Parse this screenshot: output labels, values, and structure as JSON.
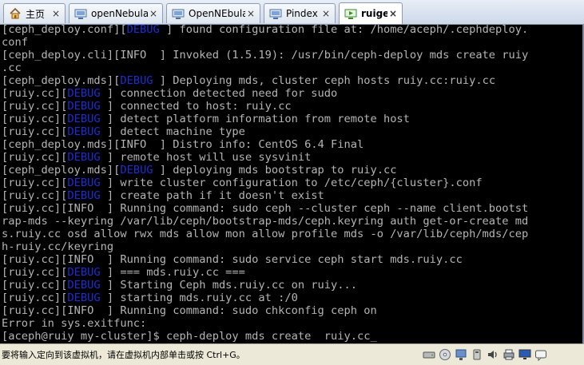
{
  "tabs": [
    {
      "label": "主页",
      "icon": "home-icon",
      "active": false
    },
    {
      "label": "openNebula",
      "icon": "vm-icon",
      "active": false
    },
    {
      "label": "OpenNEbula",
      "icon": "vm-icon",
      "active": false
    },
    {
      "label": "Pindex",
      "icon": "vm-icon",
      "active": false
    },
    {
      "label": "ruige",
      "icon": "vm-running-icon",
      "active": true
    }
  ],
  "tab_close_glyph": "×",
  "console": {
    "lines": [
      [
        {
          "t": "[ceph_deploy.conf]["
        },
        {
          "t": "DEBUG",
          "d": 1
        },
        {
          "t": " ] found configuration file at: /home/aceph/.cephdeploy."
        }
      ],
      [
        {
          "t": "conf"
        }
      ],
      [
        {
          "t": "[ceph_deploy.cli][INFO  ] Invoked (1.5.19): /usr/bin/ceph-deploy mds create ruiy"
        }
      ],
      [
        {
          "t": ".cc"
        }
      ],
      [
        {
          "t": "[ceph_deploy.mds]["
        },
        {
          "t": "DEBUG",
          "d": 1
        },
        {
          "t": " ] Deploying mds, cluster ceph hosts ruiy.cc:ruiy.cc"
        }
      ],
      [
        {
          "t": "[ruiy.cc]["
        },
        {
          "t": "DEBUG",
          "d": 1
        },
        {
          "t": " ] connection detected need for sudo"
        }
      ],
      [
        {
          "t": "[ruiy.cc]["
        },
        {
          "t": "DEBUG",
          "d": 1
        },
        {
          "t": " ] connected to host: ruiy.cc"
        }
      ],
      [
        {
          "t": "[ruiy.cc]["
        },
        {
          "t": "DEBUG",
          "d": 1
        },
        {
          "t": " ] detect platform information from remote host"
        }
      ],
      [
        {
          "t": "[ruiy.cc]["
        },
        {
          "t": "DEBUG",
          "d": 1
        },
        {
          "t": " ] detect machine type"
        }
      ],
      [
        {
          "t": "[ceph_deploy.mds][INFO  ] Distro info: CentOS 6.4 Final"
        }
      ],
      [
        {
          "t": "[ruiy.cc]["
        },
        {
          "t": "DEBUG",
          "d": 1
        },
        {
          "t": " ] remote host will use sysvinit"
        }
      ],
      [
        {
          "t": "[ceph_deploy.mds]["
        },
        {
          "t": "DEBUG",
          "d": 1
        },
        {
          "t": " ] deploying mds bootstrap to ruiy.cc"
        }
      ],
      [
        {
          "t": "[ruiy.cc]["
        },
        {
          "t": "DEBUG",
          "d": 1
        },
        {
          "t": " ] write cluster configuration to /etc/ceph/{cluster}.conf"
        }
      ],
      [
        {
          "t": "[ruiy.cc]["
        },
        {
          "t": "DEBUG",
          "d": 1
        },
        {
          "t": " ] create path if it doesn't exist"
        }
      ],
      [
        {
          "t": "[ruiy.cc][INFO  ] Running command: sudo ceph --cluster ceph --name client.bootst"
        }
      ],
      [
        {
          "t": "rap-mds --keyring /var/lib/ceph/bootstrap-mds/ceph.keyring auth get-or-create md"
        }
      ],
      [
        {
          "t": "s.ruiy.cc osd allow rwx mds allow mon allow profile mds -o /var/lib/ceph/mds/cep"
        }
      ],
      [
        {
          "t": "h-ruiy.cc/keyring"
        }
      ],
      [
        {
          "t": "[ruiy.cc][INFO  ] Running command: sudo service ceph start mds.ruiy.cc"
        }
      ],
      [
        {
          "t": "[ruiy.cc]["
        },
        {
          "t": "DEBUG",
          "d": 1
        },
        {
          "t": " ] === mds.ruiy.cc ==="
        }
      ],
      [
        {
          "t": "[ruiy.cc]["
        },
        {
          "t": "DEBUG",
          "d": 1
        },
        {
          "t": " ] Starting Ceph mds.ruiy.cc on ruiy..."
        }
      ],
      [
        {
          "t": "[ruiy.cc]["
        },
        {
          "t": "DEBUG",
          "d": 1
        },
        {
          "t": " ] starting mds.ruiy.cc at :/0"
        }
      ],
      [
        {
          "t": "[ruiy.cc][INFO  ] Running command: sudo chkconfig ceph on"
        }
      ],
      [
        {
          "t": "Error in sys.exitfunc:"
        }
      ],
      [
        {
          "t": "[aceph@ruiy my-cluster]$ ceph-deploy mds create  ruiy.cc"
        },
        {
          "t": "_",
          "c": 1
        }
      ]
    ],
    "text_color": "#b5b5b5",
    "debug_color": "#1a2fd0",
    "background": "#000000"
  },
  "statusbar": {
    "message": "要将输入定向到该虚拟机，请在虚拟机内部单击或按 Ctrl+G。",
    "icons": [
      "hard-disk-icon",
      "cd-rom-icon",
      "network-icon",
      "usb-icon",
      "sound-icon",
      "printer-icon",
      "display-icon",
      "message-icon"
    ]
  }
}
